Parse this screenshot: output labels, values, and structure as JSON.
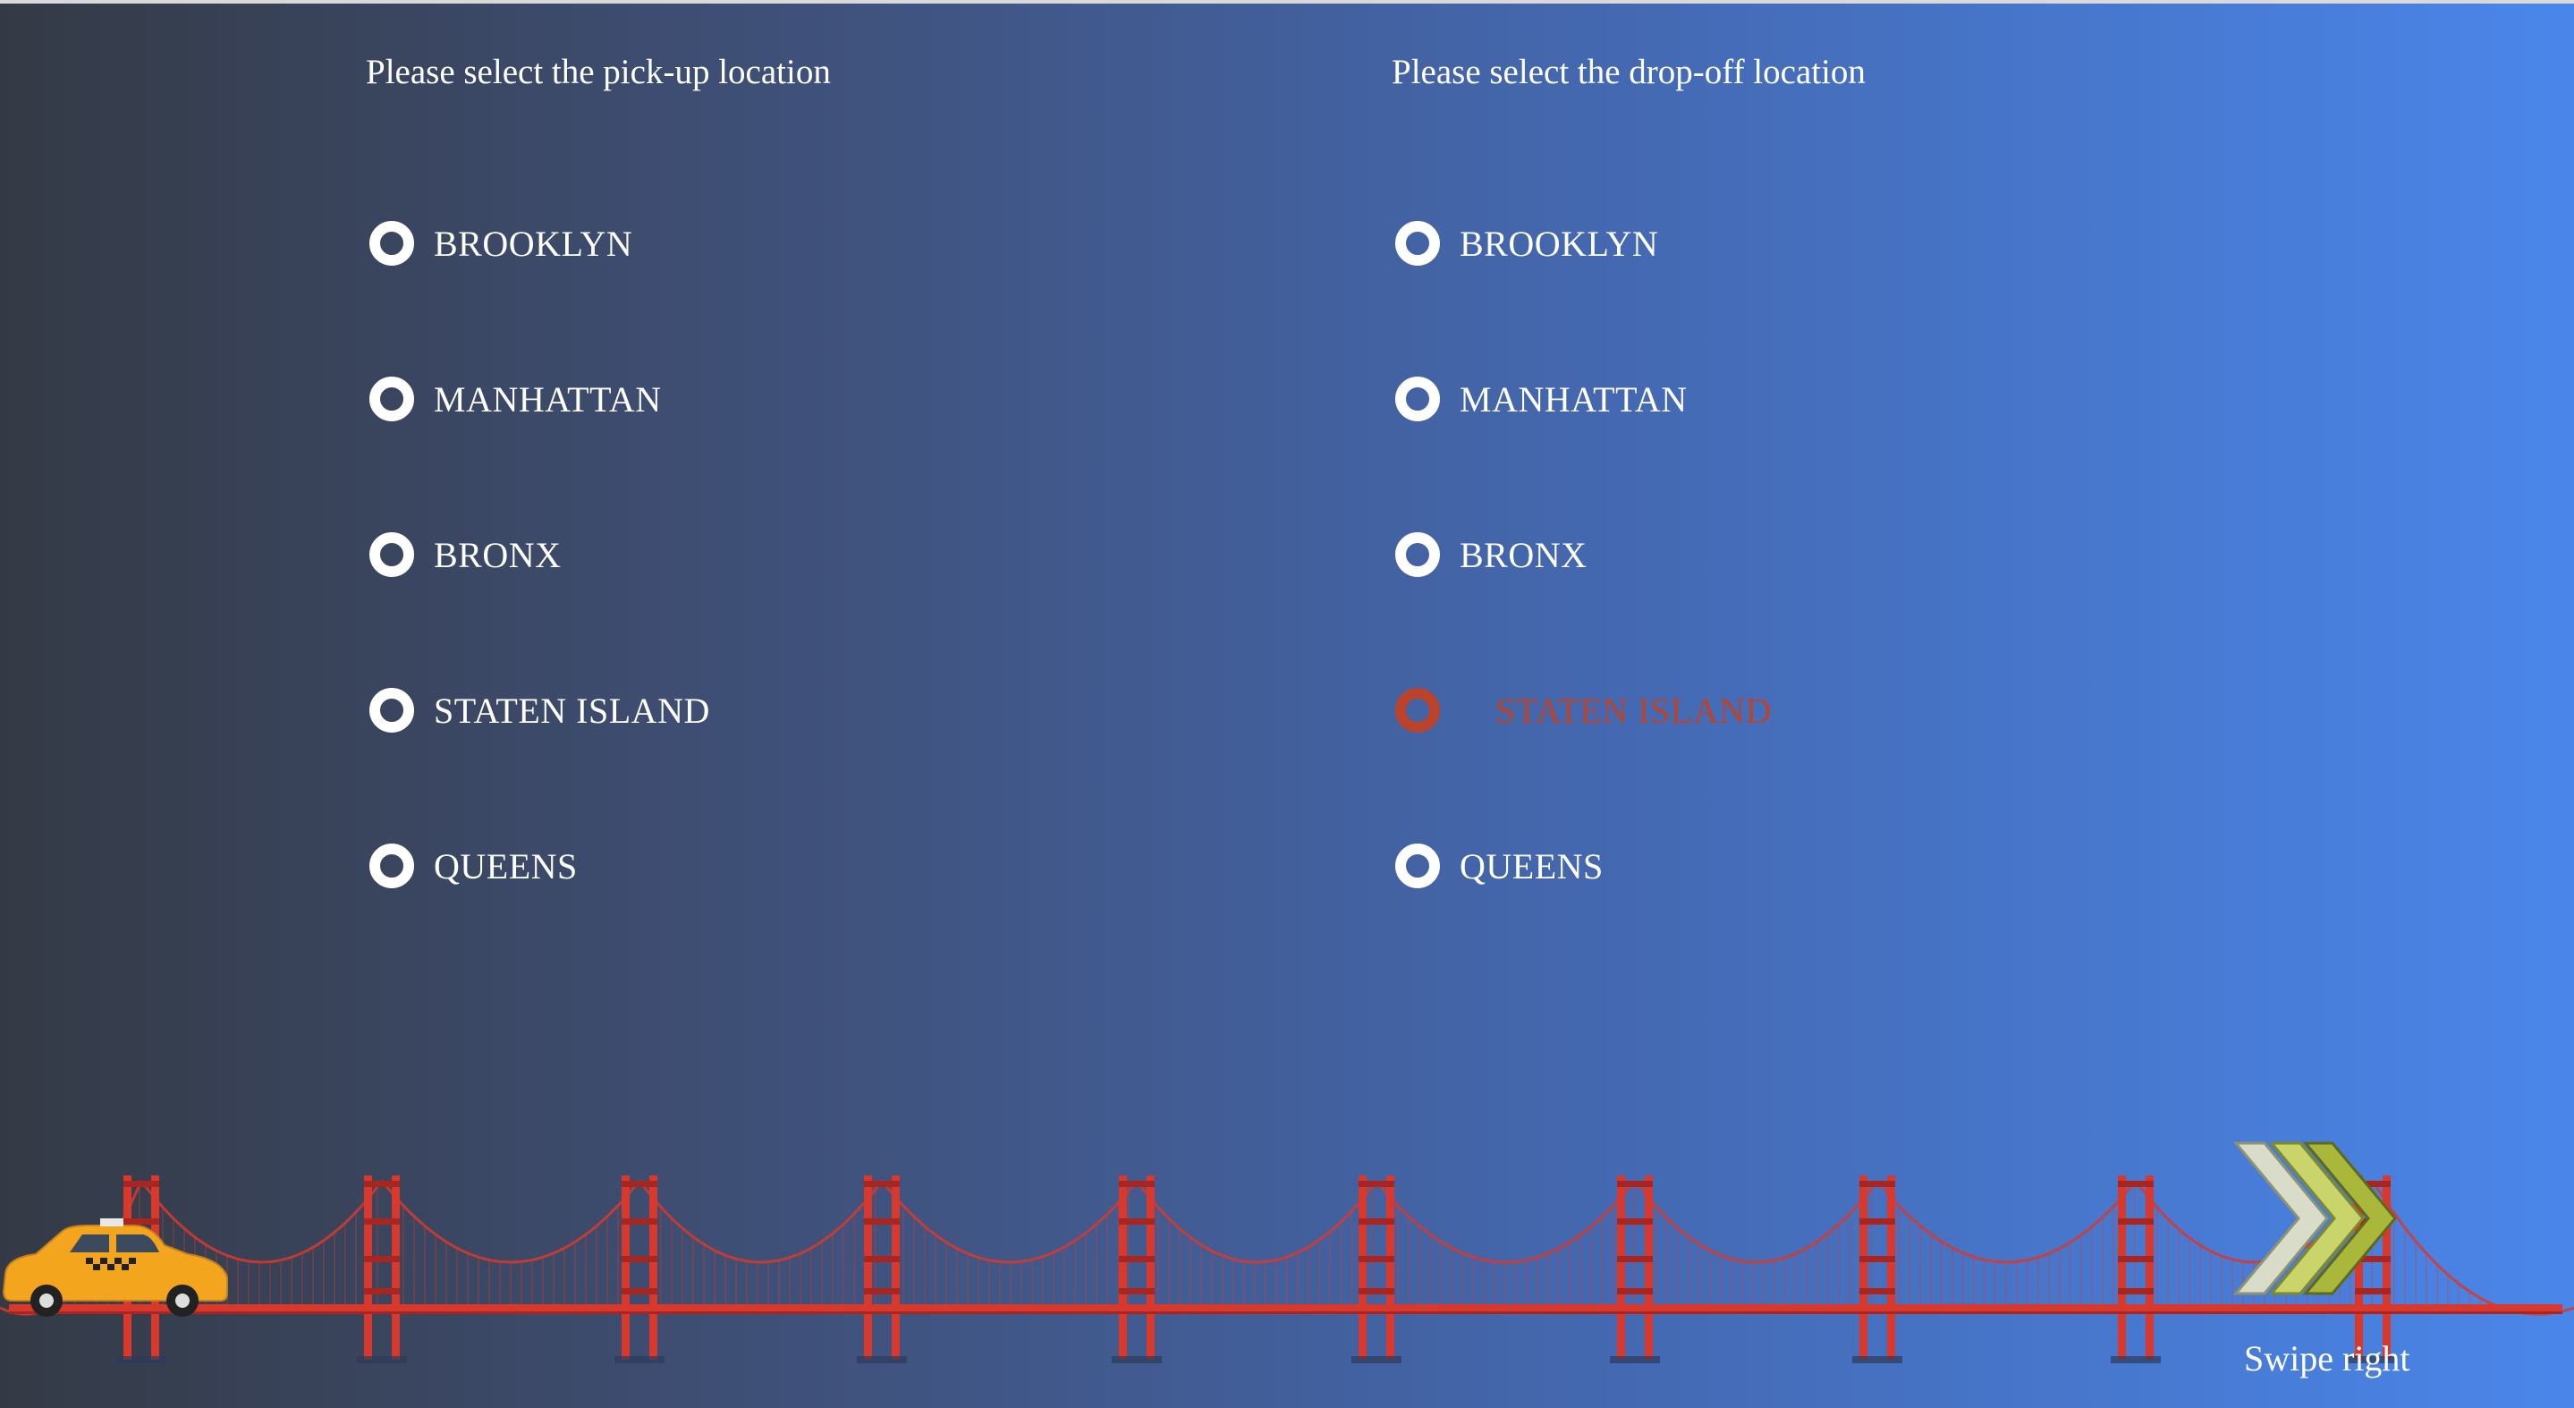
{
  "pickup": {
    "heading": "Please select the pick-up location",
    "options": [
      "BROOKLYN",
      "MANHATTAN",
      "BRONX",
      "STATEN ISLAND",
      "QUEENS"
    ],
    "selected": null
  },
  "dropoff": {
    "heading": "Please select the drop-off location",
    "options": [
      "BROOKLYN",
      "MANHATTAN",
      "BRONX",
      "STATEN ISLAND",
      "QUEENS"
    ],
    "selected": "STATEN ISLAND"
  },
  "swipe": {
    "label": "Swipe right"
  },
  "icons": {
    "taxi": "taxi-icon",
    "bridge": "bridge-illustration",
    "swipe": "chevrons-right-icon"
  },
  "colors": {
    "selected": "#b9442b",
    "bridge": "#d9382c",
    "bridge_dark": "#a8261f",
    "taxi": "#f2a51d",
    "chevron": "#c8d65a",
    "gradient_start": "#343a45",
    "gradient_end": "#4a86ea"
  }
}
